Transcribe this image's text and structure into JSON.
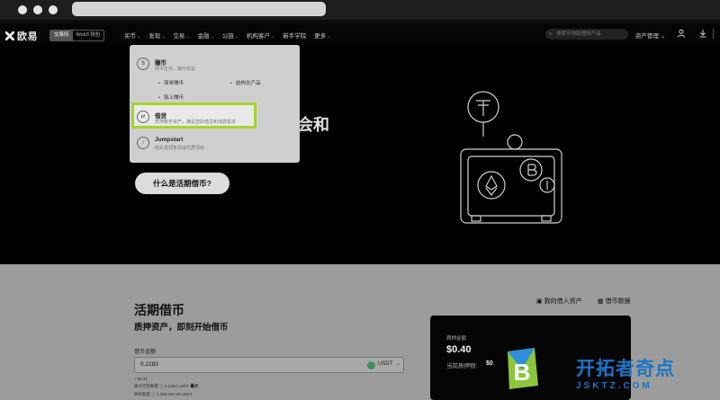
{
  "nav": {
    "logo": "欧易",
    "toggle": [
      "交易所",
      "Web3 钱包"
    ],
    "menu": [
      "买币",
      "发现",
      "交易",
      "金融",
      "公链",
      "机构客户",
      "新手学院",
      "更多"
    ],
    "search_placeholder": "搜索币种和理财产品",
    "assets": "资产管理"
  },
  "dropdown": {
    "items": [
      {
        "title": "赚币",
        "desc": "持币生币，赚币收益"
      },
      {
        "title": "借贷",
        "desc": "质押数字资产，满足您的借贷和消费需求"
      },
      {
        "title": "Jumpstart",
        "desc": "抢先发现各领域优质项目"
      }
    ],
    "sub_items": [
      "简单赚币",
      "结构化产品",
      "链上赚币"
    ]
  },
  "hero": {
    "title_fragment": "会和",
    "cta": "什么是活期借币?"
  },
  "lower": {
    "title": "活期借币",
    "subtitle": "质押资产，即刻开始借币",
    "link_my_loans": "我的借入资产",
    "link_data": "借币数据",
    "amount_label": "借币金额",
    "amount_value": "0.2283",
    "amount_unit": "USDT",
    "meta_usd": "≈ $0.22",
    "meta_max_label": "最大可借数量",
    "meta_max_value": "0.2283 USDT",
    "meta_max_btn": "最大",
    "meta_remaining_label": "剩余额度",
    "meta_remaining_value": "3,395,000.00 USDT"
  },
  "card": {
    "label": "质押金额",
    "value": "$0.40",
    "label2": "当前质押物:",
    "value2": "$0"
  },
  "watermark": {
    "name": "开拓者奇点",
    "url": "JSKTZ.COM"
  },
  "colors": {
    "highlight": "#a4d62c",
    "watermark": "#1a75c9",
    "usdt": "#3e8f5d"
  }
}
